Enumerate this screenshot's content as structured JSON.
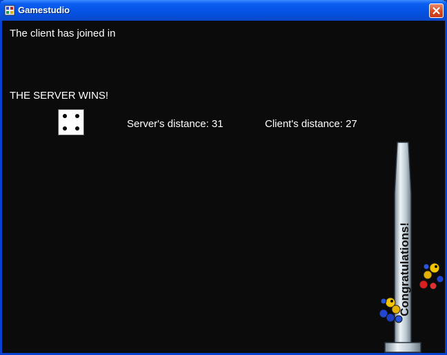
{
  "window": {
    "title": "Gamestudio"
  },
  "game": {
    "status_message": "The client has joined in",
    "result_message": "THE SERVER WINS!",
    "die_face": 4,
    "server_distance": "Server's distance: 31",
    "client_distance": "Client's distance: 27"
  },
  "banner": {
    "text": "Congratulations!"
  },
  "icons": {
    "close": "close-icon",
    "app": "app-icon",
    "die": "die-icon"
  },
  "colors": {
    "titlebar": "#0452e3",
    "close": "#d9481f",
    "background": "#0b0b0b",
    "text": "#ffffff"
  }
}
